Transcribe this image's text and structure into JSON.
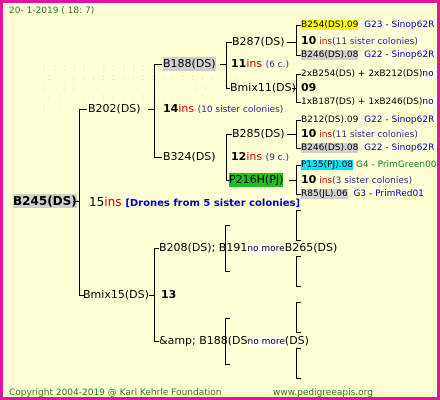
{
  "header": {
    "date": "20-  1-2019  ( 18:  7)"
  },
  "root": {
    "name": "B245(DS)",
    "count": "15",
    "ins": "ins",
    "drones": "[Drones from 5 sister colonies]"
  },
  "gen1": {
    "a": {
      "name": "B202(DS)",
      "count": "14",
      "ins": "ins",
      "note": "(10 sister colonies)"
    },
    "b": {
      "name": "Bmix15(DS)",
      "count": "13"
    }
  },
  "gen2": {
    "a": {
      "name": "B188(DS)",
      "count": "11",
      "ins": "ins",
      "note": "(6 c.)"
    },
    "b": {
      "name": "B324(DS)",
      "count": "12",
      "ins": "ins",
      "note": "(9 c.)"
    },
    "c": {
      "name": "B208(DS); B191",
      "more": "no more",
      "tail": "B265(DS)"
    },
    "d": {
      "name": "&amp; B188(DS",
      "more": "no more",
      "tail": "(DS)"
    }
  },
  "gen3": {
    "a": {
      "name": "B287(DS)"
    },
    "b": {
      "name": "Bmix11(DS)"
    },
    "c": {
      "name": "B285(DS)"
    },
    "d": {
      "name": "P216H(PJ)"
    }
  },
  "gen4": [
    {
      "name": "B254(DS).09",
      "group": "G23 - Sinop62R"
    },
    {
      "count": "10",
      "ins": "ins",
      "note": "(11 sister colonies)"
    },
    {
      "name": "B246(DS).08",
      "group": "G22 - Sinop62R"
    },
    {
      "text": "2xB254(DS) + 2xB212(DS)",
      "more": "no more"
    },
    {
      "count": "09"
    },
    {
      "text": "1xB187(DS) + 1xB246(DS)",
      "more": "no more"
    },
    {
      "name": "B212(DS).09",
      "group": "G22 - Sinop62R"
    },
    {
      "count": "10",
      "ins": "ins",
      "note": "(11 sister colonies)"
    },
    {
      "name": "B246(DS).08",
      "group": "G22 - Sinop62R"
    },
    {
      "name": "P135(PJ).08",
      "group": "G4 - PrimGreen00"
    },
    {
      "count": "10",
      "ins": "ins",
      "note": "(3 sister colonies)"
    },
    {
      "name": "R85(JL).06",
      "group": "G3 - PrimRed01"
    }
  ],
  "footer": {
    "copyright": "Copyright 2004-2019 @ Karl Kehrle Foundation",
    "site": "www.pedigreeapis.org"
  }
}
